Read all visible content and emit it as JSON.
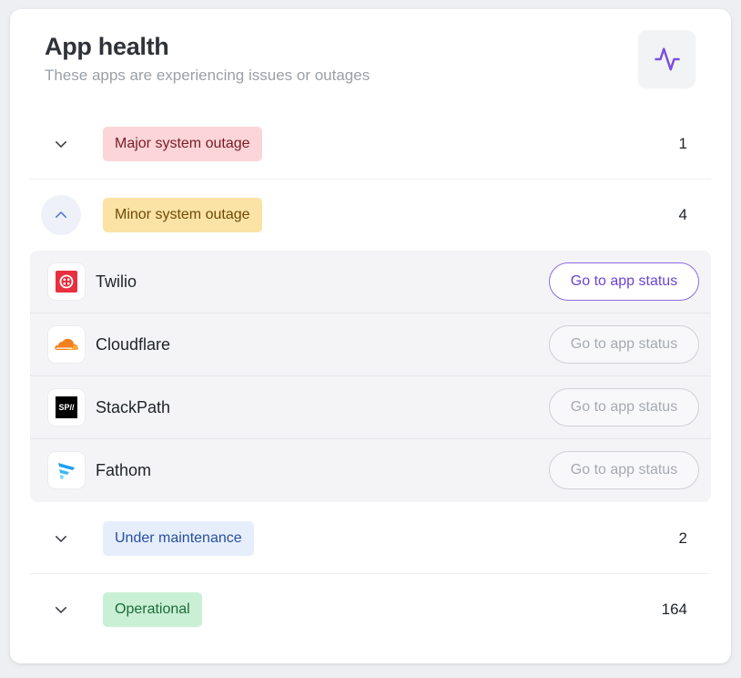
{
  "header": {
    "title": "App health",
    "subtitle": "These apps are experiencing issues or outages",
    "icon": "activity-icon"
  },
  "groups": [
    {
      "label": "Major system outage",
      "count": "1",
      "expanded": false,
      "color": "#fbd5d8"
    },
    {
      "label": "Minor system outage",
      "count": "4",
      "expanded": true,
      "color": "#fbe3a6"
    },
    {
      "label": "Under maintenance",
      "count": "2",
      "expanded": false,
      "color": "#e6eefc"
    },
    {
      "label": "Operational",
      "count": "164",
      "expanded": false,
      "color": "#c9f0d5"
    }
  ],
  "apps": [
    {
      "name": "Twilio",
      "logo": "twilio-logo",
      "button": "Go to app status",
      "enabled": true
    },
    {
      "name": "Cloudflare",
      "logo": "cloudflare-logo",
      "button": "Go to app status",
      "enabled": false
    },
    {
      "name": "StackPath",
      "logo": "stackpath-logo",
      "logo_text": "SP//",
      "button": "Go to app status",
      "enabled": false
    },
    {
      "name": "Fathom",
      "logo": "fathom-logo",
      "button": "Go to app status",
      "enabled": false
    }
  ],
  "colors": {
    "accent": "#6a44d6"
  }
}
